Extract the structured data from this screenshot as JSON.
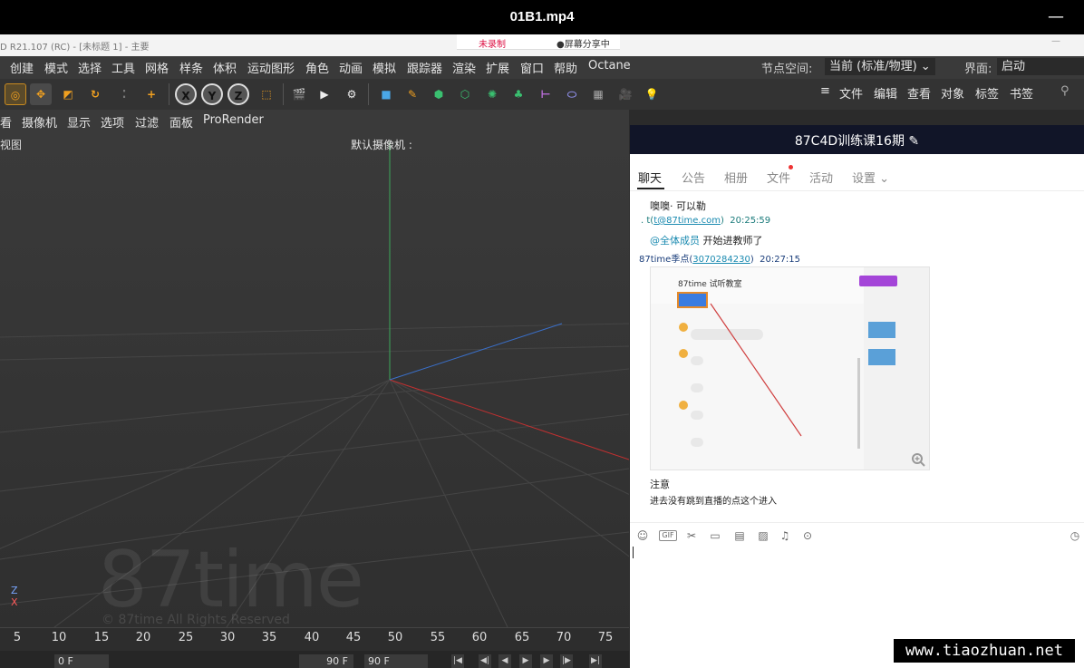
{
  "player": {
    "title": "01B1.mp4",
    "minimize_glyph": "—"
  },
  "c4d_window": {
    "title": "D R21.107 (RC) - [未标题 1] - 主要",
    "recording": "未录制",
    "screen_share": "●屏幕分享中",
    "minimize": "—"
  },
  "menu": {
    "items": [
      "创建",
      "模式",
      "选择",
      "工具",
      "网格",
      "样条",
      "体积",
      "运动图形",
      "角色",
      "动画",
      "模拟",
      "跟踪器",
      "渲染",
      "扩展",
      "窗口",
      "帮助",
      "Octane"
    ],
    "node_space_label": "节点空间:",
    "node_space_value": "当前 (标准/物理)",
    "interface_label": "界面:",
    "interface_value": "启动"
  },
  "object_manager_menu": [
    "文件",
    "编辑",
    "查看",
    "对象",
    "标签",
    "书签"
  ],
  "viewport_menu": [
    "看",
    "摄像机",
    "显示",
    "选项",
    "过滤",
    "面板",
    "ProRender"
  ],
  "viewport": {
    "view_label": "视图",
    "camera_label": "默认摄像机 :",
    "watermark": "87time",
    "watermark_rights": "© 87time All Rights Reserved",
    "axis_z": "Z",
    "axis_x": "X"
  },
  "timeline": {
    "ticks": [
      "5",
      "10",
      "15",
      "20",
      "25",
      "30",
      "35",
      "40",
      "45",
      "50",
      "55",
      "60",
      "65",
      "70",
      "75"
    ],
    "start_frame": "0 F",
    "end_frame": "90 F",
    "end_frame2": "90 F"
  },
  "chat": {
    "group_title": "87C4D训练课16期",
    "tabs": [
      "聊天",
      "公告",
      "相册",
      "文件",
      "活动",
      "设置"
    ],
    "messages": [
      {
        "text": "噢噢· 可以勒"
      },
      {
        "sender_prefix": ". t(",
        "sender_link": "t@87time.com",
        "sender_suffix": ")",
        "time": "20:25:59"
      },
      {
        "mention": "@全体成员",
        "text": " 开始进教师了"
      },
      {
        "sender_prefix": "87time季点(",
        "sender_link": "3070284230",
        "sender_suffix": ")",
        "time": "20:27:15"
      }
    ],
    "screenshot_title": "87time 试听教室",
    "notice_title": "注意",
    "notice_text": "进去没有跳到直播的点这个进入"
  },
  "site_watermark": "www.tiaozhuan.net",
  "colors": {
    "chat_header": "#111528",
    "menu_bg": "#3a3a3a",
    "accent_orange": "#e58a2a"
  }
}
